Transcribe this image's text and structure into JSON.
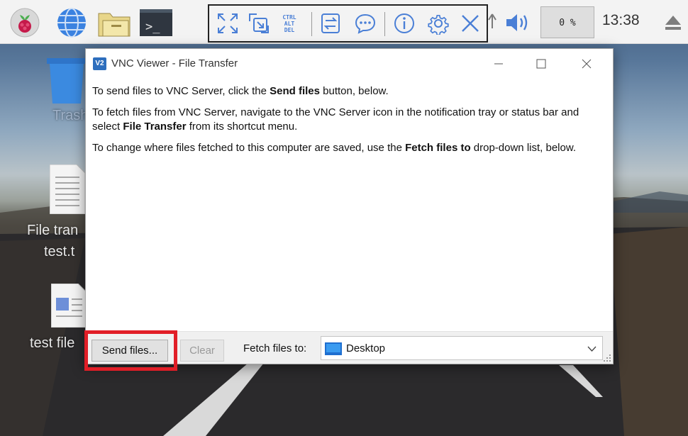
{
  "taskbar": {
    "cpu_usage": "0 %",
    "clock": "13:38",
    "icons": [
      "raspberry-pi-menu-icon",
      "web-browser-icon",
      "file-manager-icon",
      "terminal-icon"
    ],
    "vnc_toolbar_icons": [
      "full-screen-icon",
      "scale-icon",
      "ctrl-alt-del-icon",
      "file-transfer-icon",
      "chat-icon",
      "info-icon",
      "settings-icon",
      "close-icon"
    ],
    "tray_icons": [
      "up-arrow-icon",
      "volume-icon",
      "eject-icon"
    ]
  },
  "desktop": {
    "icons": [
      {
        "label": "Trash"
      },
      {
        "label_line1": "File tran",
        "label_line2": "test.t"
      },
      {
        "label": "test file"
      }
    ]
  },
  "dialog": {
    "title": "VNC Viewer - File Transfer",
    "app_icon": "V2",
    "paragraph1": {
      "before": "To send files to VNC Server, click the ",
      "bold": "Send files",
      "after": " button, below."
    },
    "paragraph2": {
      "before": "To fetch files from VNC Server, navigate to the VNC Server icon in the notification tray or status bar and select ",
      "bold": "File Transfer",
      "after": " from its shortcut menu."
    },
    "paragraph3": {
      "before": "To change where files fetched to this computer are saved, use the ",
      "bold": "Fetch files to",
      "after": " drop-down list, below."
    },
    "send_files_label": "Send files...",
    "clear_label": "Clear",
    "fetch_label": "Fetch files to:",
    "fetch_value": "Desktop"
  },
  "colors": {
    "highlight": "#e11e27",
    "accent": "#2d6ebd",
    "toolbar_icon": "#4a7fd6"
  }
}
